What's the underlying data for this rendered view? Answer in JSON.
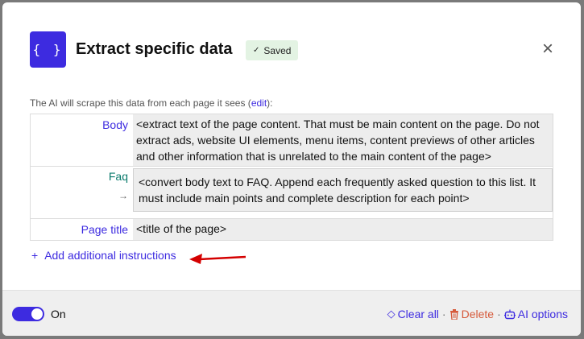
{
  "header": {
    "icon_text": "{ }",
    "title": "Extract specific data",
    "saved_badge": "Saved",
    "close_glyph": "×"
  },
  "intro": {
    "text_before": "The AI will scrape this data from each page it sees (",
    "edit_link": "edit",
    "text_after": "):"
  },
  "fields": [
    {
      "key": "Body",
      "value": "<extract text of the page content. That must be main content on the page. Do not extract ads, website UI elements, menu items, content previews of other articles and other information that is unrelated to the main content of the page>"
    },
    {
      "key": "Faq",
      "arrow": "→",
      "value": "<convert body text to FAQ. Append each frequently asked question to this list. It must include main points and complete description for each point>"
    },
    {
      "key": "Page title",
      "value": "<title of the page>"
    }
  ],
  "add_instructions": {
    "plus": "+",
    "label": "Add additional instructions"
  },
  "footer": {
    "toggle_label": "On",
    "clear_all": "Clear all",
    "delete": "Delete",
    "ai_options": "AI options",
    "separator": "·"
  },
  "colors": {
    "accent": "#3d2be0",
    "delete": "#d65a3b",
    "saved_bg": "#e3f3e3",
    "arrow": "#d40000"
  }
}
